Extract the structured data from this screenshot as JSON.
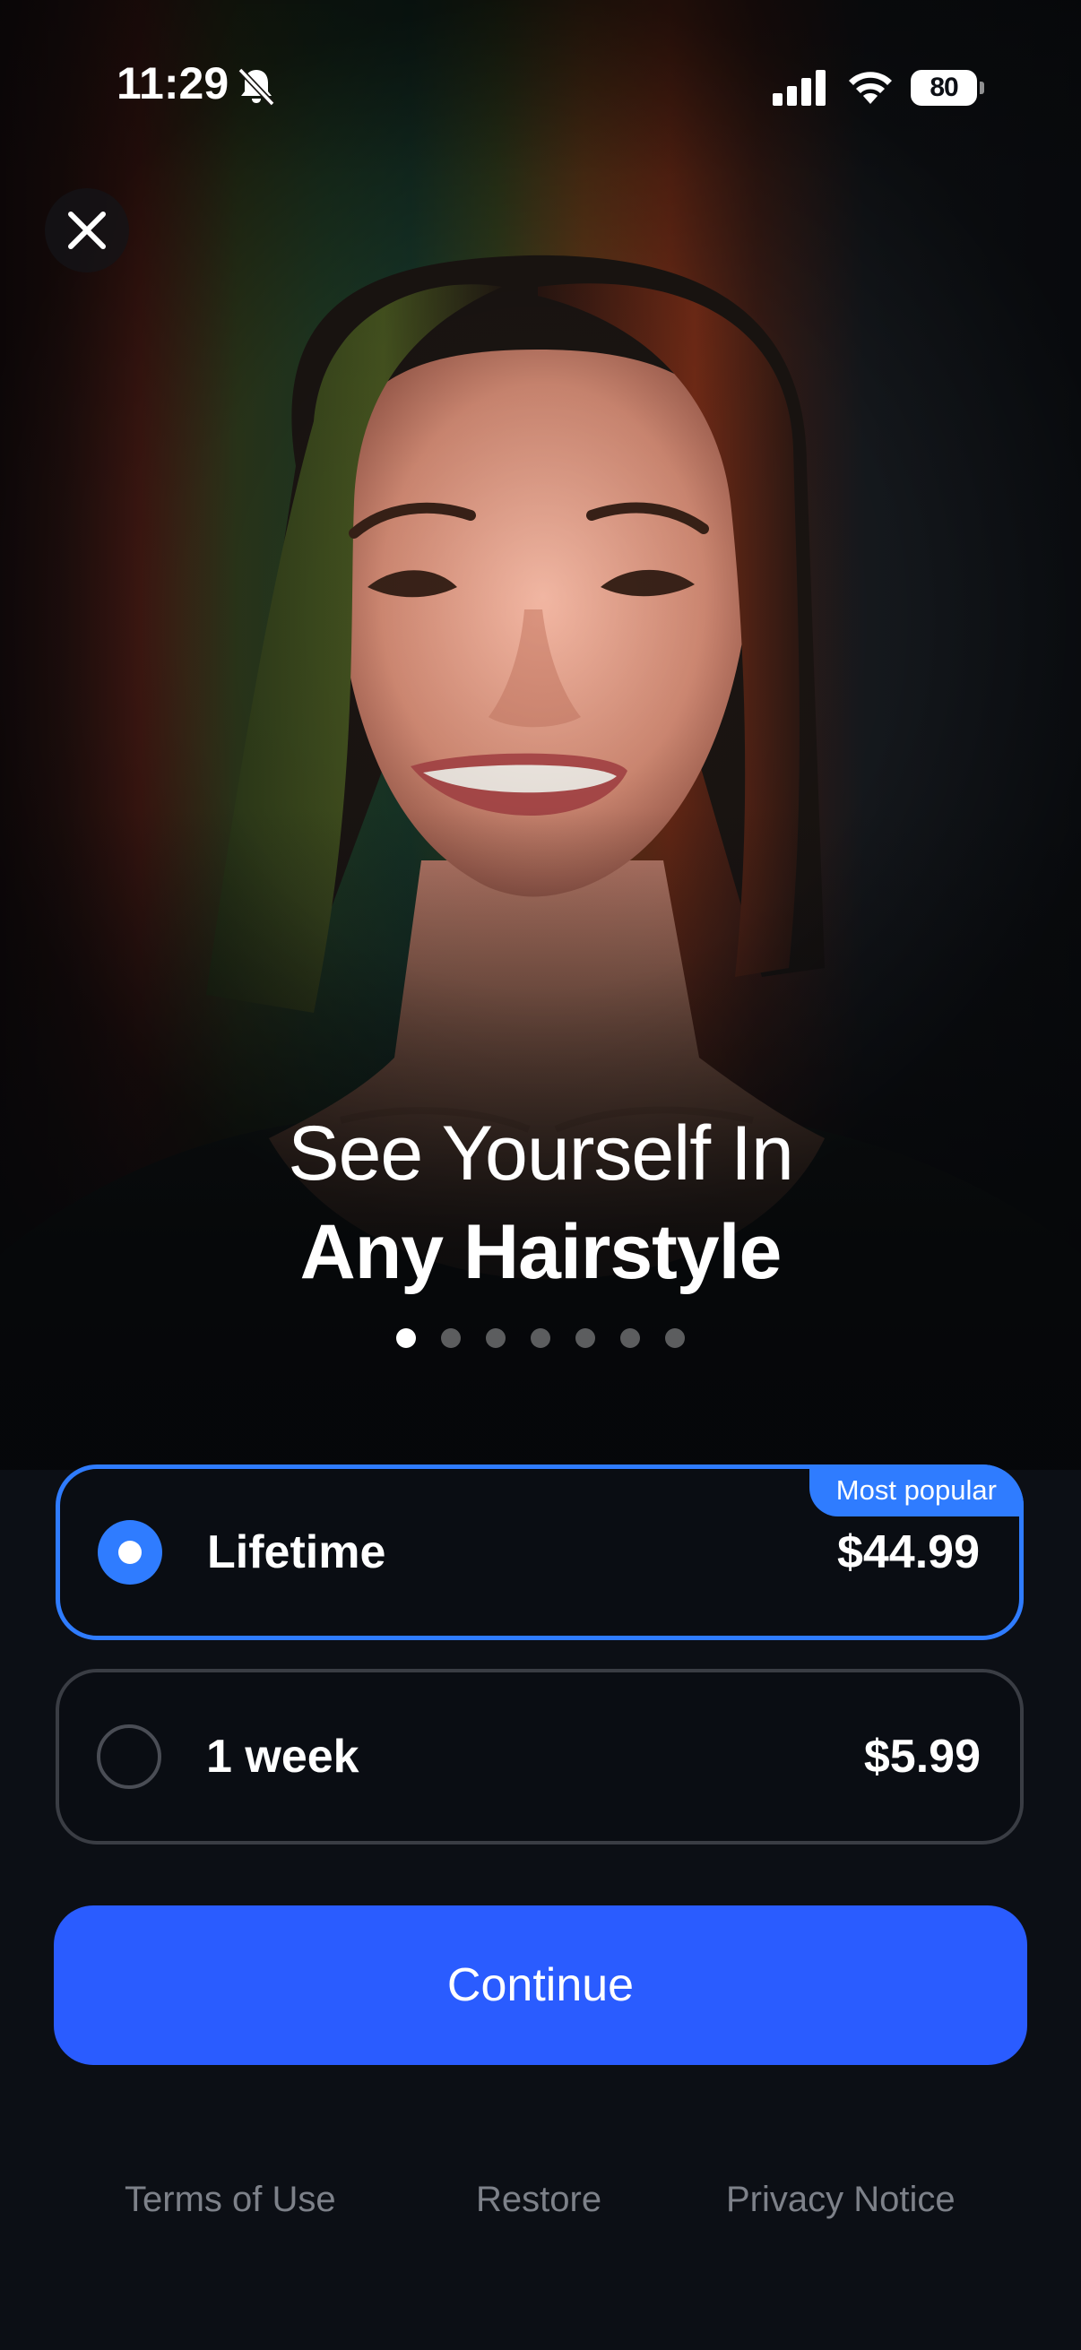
{
  "status_bar": {
    "time": "11:29",
    "battery": "80",
    "icons": [
      "bell-slash-icon",
      "cellular-signal-icon",
      "wifi-icon",
      "battery-charging-icon"
    ]
  },
  "close_button": {
    "icon": "close-icon"
  },
  "hero": {
    "headline_line1": "See Yourself In",
    "headline_line2": "Any Hairstyle",
    "page_count": 7,
    "active_page": 1
  },
  "plans": [
    {
      "name": "Lifetime",
      "price": "$44.99",
      "badge": "Most popular",
      "selected": true
    },
    {
      "name": "1 week",
      "price": "$5.99",
      "selected": false
    }
  ],
  "cta": {
    "label": "Continue"
  },
  "footer": {
    "terms": "Terms of Use",
    "restore": "Restore",
    "privacy": "Privacy Notice"
  },
  "colors": {
    "accent": "#2f7cff",
    "button": "#2a5cff",
    "background": "#0c0f15",
    "muted_text": "#7d8189"
  }
}
